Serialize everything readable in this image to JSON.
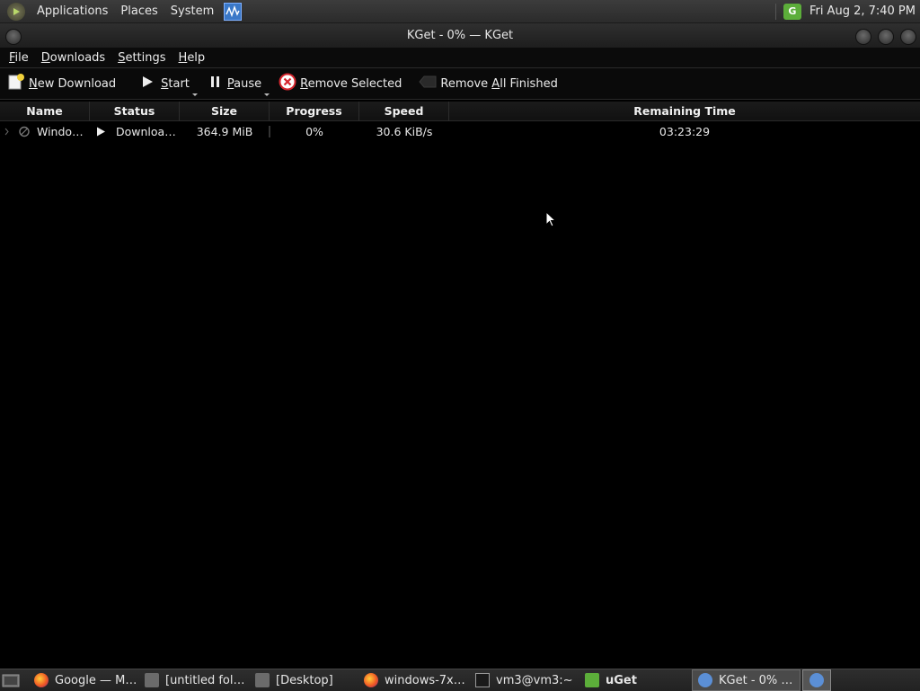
{
  "top_panel": {
    "menus": [
      "Applications",
      "Places",
      "System"
    ],
    "clock": "Fri Aug  2,  7:40 PM",
    "uget_label": "G"
  },
  "window": {
    "title": "KGet - 0% — KGet"
  },
  "menubar": [
    {
      "u": "F",
      "rest": "ile"
    },
    {
      "u": "D",
      "rest": "ownloads"
    },
    {
      "u": "S",
      "rest": "ettings"
    },
    {
      "u": "H",
      "rest": "elp"
    }
  ],
  "toolbar": {
    "new_download": {
      "u": "N",
      "rest": "ew Download"
    },
    "start": {
      "pre": "",
      "u": "S",
      "rest": "tart"
    },
    "pause": {
      "pre": "",
      "u": "P",
      "rest": "ause"
    },
    "remove_selected": {
      "u": "R",
      "rest": "emove Selected"
    },
    "remove_finished": {
      "pre": "Remove ",
      "u": "A",
      "rest": "ll Finished"
    }
  },
  "table": {
    "columns": [
      "Name",
      "Status",
      "Size",
      "Progress",
      "Speed",
      "Remaining Time"
    ],
    "rows": [
      {
        "name": "Windo…",
        "status": "Downloa…",
        "size": "364.9 MiB",
        "progress": "0%",
        "speed": "30.6 KiB/s",
        "remaining": "03:23:29"
      }
    ]
  },
  "taskbar": {
    "tasks": [
      {
        "label": "Google — M…",
        "icon": "firefox-icon"
      },
      {
        "label": "[untitled fol…",
        "icon": "folder-icon"
      },
      {
        "label": "[Desktop]",
        "icon": "folder-icon"
      },
      {
        "label": "windows-7x…",
        "icon": "firefox-icon"
      },
      {
        "label": "vm3@vm3:~",
        "icon": "terminal-icon"
      },
      {
        "label": "uGet",
        "icon": "uget-icon"
      },
      {
        "label": "KGet - 0% …",
        "icon": "kget-icon",
        "active": true
      }
    ]
  }
}
